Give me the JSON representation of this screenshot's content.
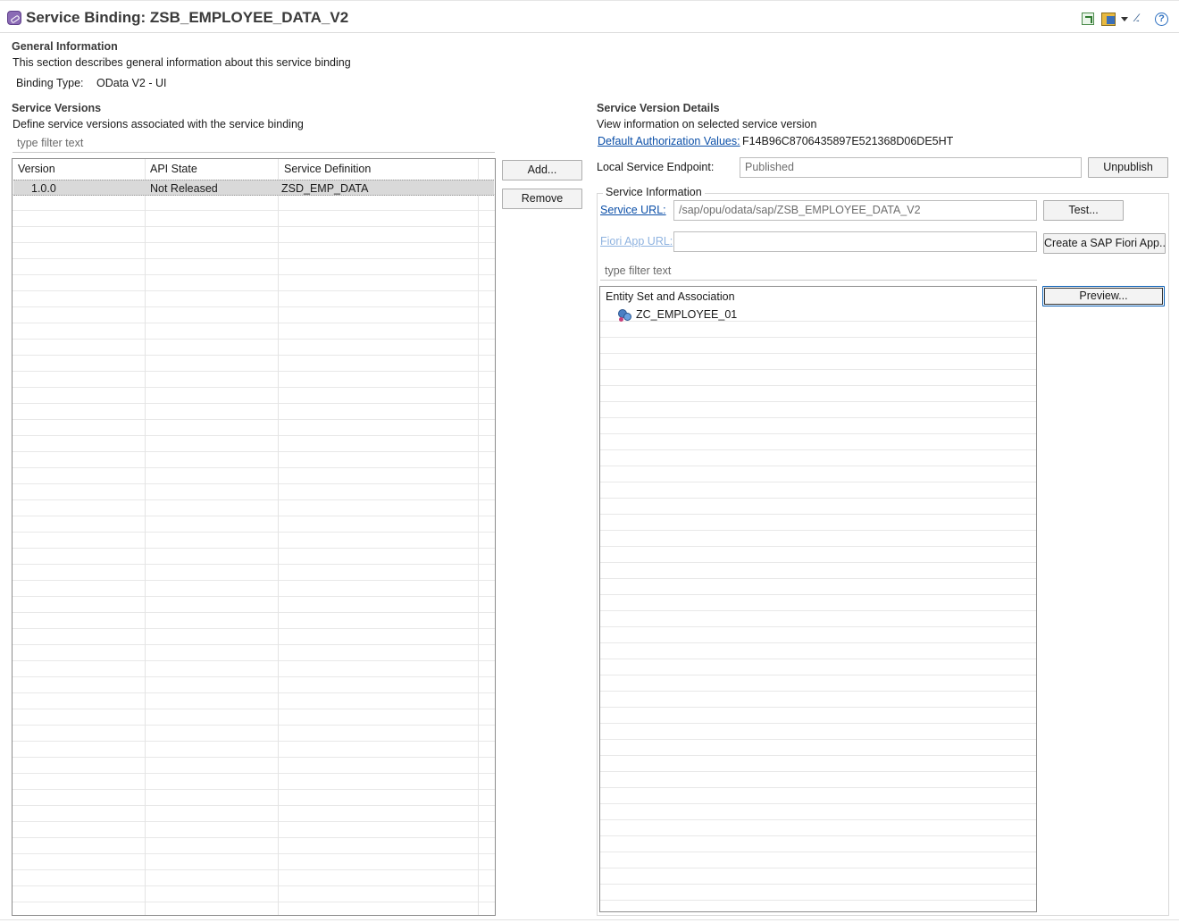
{
  "header": {
    "title": "Service Binding: ZSB_EMPLOYEE_DATA_V2",
    "toolbar_icons": [
      "export-icon",
      "generate-icon",
      "dropdown-arrow-icon",
      "word-wrap-icon",
      "help-icon"
    ],
    "help_glyph": "?"
  },
  "general": {
    "heading": "General Information",
    "description": "This section describes general information about this service binding",
    "binding_type_label": "Binding Type:",
    "binding_type_value": "OData V2 - UI"
  },
  "versions": {
    "heading": "Service Versions",
    "description": "Define service versions associated with the service binding",
    "filter_placeholder": "type filter text",
    "columns": [
      "Version",
      "API State",
      "Service Definition"
    ],
    "rows": [
      {
        "version": "1.0.0",
        "api_state": "Not Released",
        "service_definition": "ZSD_EMP_DATA"
      }
    ],
    "add_label": "Add...",
    "remove_label": "Remove"
  },
  "details": {
    "heading": "Service Version Details",
    "description": "View information on selected service version",
    "auth_link": "Default Authorization Values:",
    "auth_value": "F14B96C8706435897E521368D06DE5HT",
    "endpoint_label": "Local Service Endpoint:",
    "endpoint_value": "Published",
    "unpublish_label": "Unpublish"
  },
  "service_info": {
    "group_title": "Service Information",
    "service_url_link": "Service URL:",
    "service_url_value": "/sap/opu/odata/sap/ZSB_EMPLOYEE_DATA_V2",
    "test_label": "Test...",
    "fiori_link": "Fiori App URL:",
    "fiori_value": "",
    "create_fiori_label": "Create a SAP Fiori App...",
    "filter_placeholder": "type filter text",
    "tree_header": "Entity Set and Association",
    "entities": [
      "ZC_EMPLOYEE_01"
    ],
    "preview_label": "Preview..."
  },
  "colors": {
    "link": "#0b4fa8",
    "link_disabled": "#8fb3e0",
    "selected_row": "#d9d9d9",
    "title_icon": "#8b6bb5"
  }
}
